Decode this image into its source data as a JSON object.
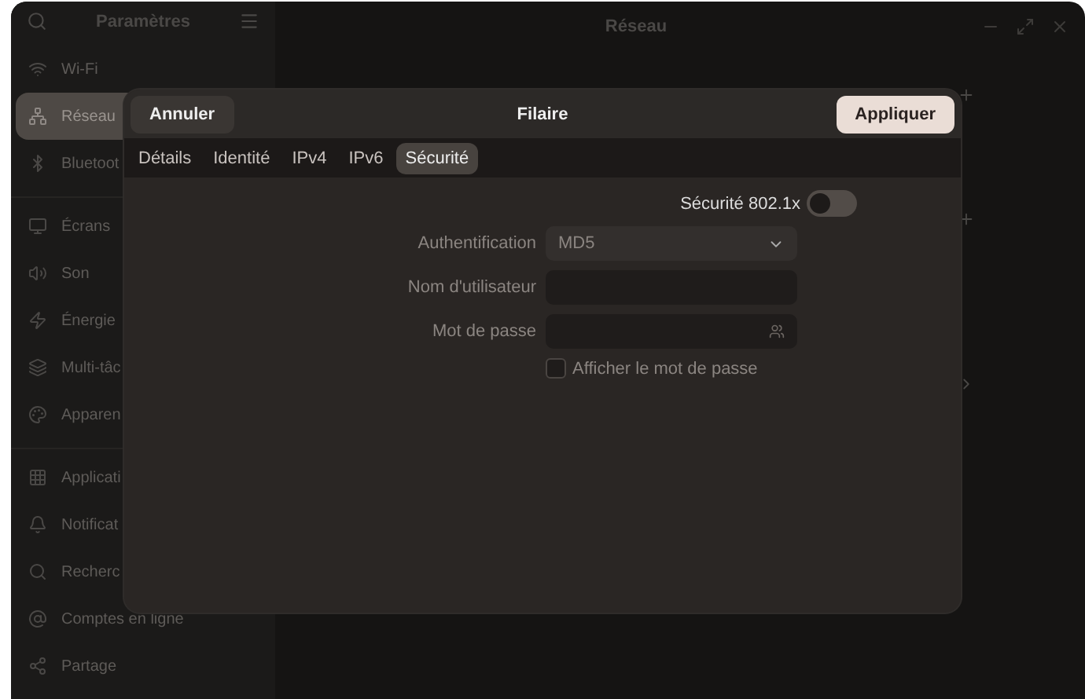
{
  "sidebar": {
    "title": "Paramètres",
    "groups": [
      [
        {
          "label": "Wi-Fi",
          "selected": false
        },
        {
          "label": "Réseau",
          "selected": true
        },
        {
          "label": "Bluetoot",
          "selected": false
        }
      ],
      [
        {
          "label": "Écrans",
          "selected": false
        },
        {
          "label": "Son",
          "selected": false
        },
        {
          "label": "Énergie",
          "selected": false
        },
        {
          "label": "Multi-tâc",
          "selected": false
        },
        {
          "label": "Apparen",
          "selected": false
        }
      ],
      [
        {
          "label": "Applicati",
          "selected": false
        },
        {
          "label": "Notificat",
          "selected": false
        },
        {
          "label": "Recherc",
          "selected": false
        },
        {
          "label": "Comptes en ligne",
          "selected": false
        },
        {
          "label": "Partage",
          "selected": false
        }
      ]
    ]
  },
  "main": {
    "title": "Réseau"
  },
  "dialog": {
    "title": "Filaire",
    "cancel": "Annuler",
    "apply": "Appliquer",
    "tabs": [
      {
        "label": "Détails",
        "selected": false
      },
      {
        "label": "Identité",
        "selected": false
      },
      {
        "label": "IPv4",
        "selected": false
      },
      {
        "label": "IPv6",
        "selected": false
      },
      {
        "label": "Sécurité",
        "selected": true
      }
    ],
    "security_toggle": {
      "label": "Sécurité 802.1x",
      "on": false
    },
    "authentication": {
      "label": "Authentification",
      "value": "MD5"
    },
    "username": {
      "label": "Nom d'utilisateur"
    },
    "password": {
      "label": "Mot de passe"
    },
    "show_password": {
      "label": "Afficher le mot de passe",
      "checked": false
    }
  }
}
